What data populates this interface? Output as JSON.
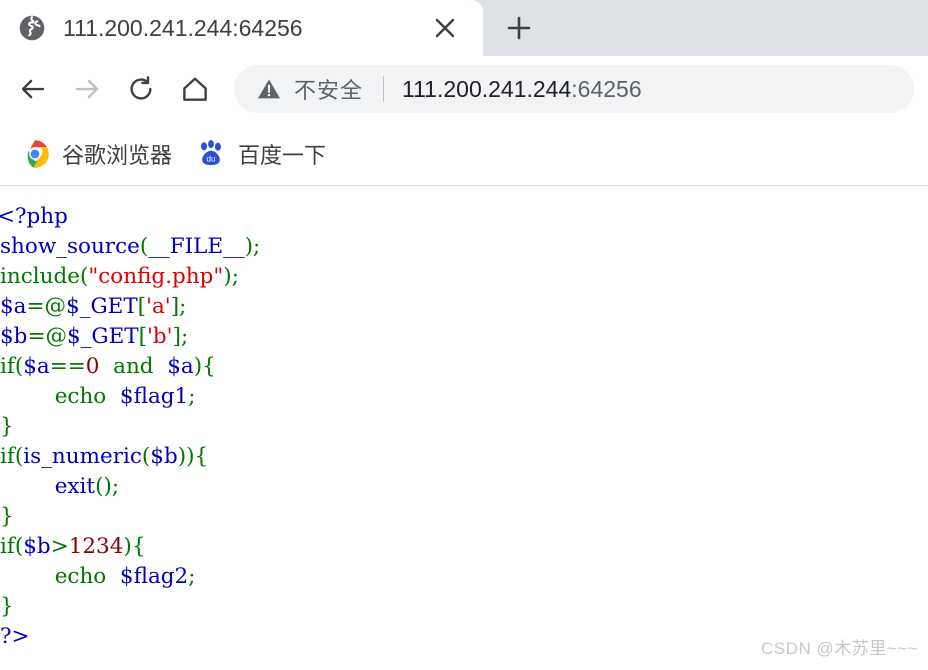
{
  "window": {
    "tab": {
      "favicon": "globe-icon",
      "title": "111.200.241.244:64256",
      "close_label": "✕"
    },
    "new_tab_label": "+"
  },
  "toolbar": {
    "back_label": "←",
    "forward_label": "→",
    "reload_label": "↻",
    "home_label": "⌂",
    "security": {
      "icon": "warning-triangle-icon",
      "text": "不安全"
    },
    "url_host": "111.200.241.244",
    "url_port": ":64256"
  },
  "bookmarks": [
    {
      "icon": "chrome-logo-icon",
      "label": "谷歌浏览器"
    },
    {
      "icon": "baidu-paw-icon",
      "label": "百度一下"
    }
  ],
  "page": {
    "code_lines": [
      {
        "tokens": [
          {
            "t": "<?php",
            "c": "var"
          }
        ]
      },
      {
        "tokens": [
          {
            "t": "show_source",
            "c": "var"
          },
          {
            "t": "(",
            "c": "kw"
          },
          {
            "t": "__FILE__",
            "c": "var"
          },
          {
            "t": ")",
            "c": "kw"
          },
          {
            "t": ";",
            "c": "kw"
          }
        ]
      },
      {
        "tokens": [
          {
            "t": "include",
            "c": "kw"
          },
          {
            "t": "(",
            "c": "kw"
          },
          {
            "t": "\"config.php\"",
            "c": "str"
          },
          {
            "t": ")",
            "c": "kw"
          },
          {
            "t": ";",
            "c": "kw"
          }
        ]
      },
      {
        "tokens": [
          {
            "t": "$a",
            "c": "var"
          },
          {
            "t": "=@",
            "c": "kw"
          },
          {
            "t": "$_GET",
            "c": "var"
          },
          {
            "t": "[",
            "c": "kw"
          },
          {
            "t": "'a'",
            "c": "str"
          },
          {
            "t": "]",
            "c": "kw"
          },
          {
            "t": ";",
            "c": "kw"
          }
        ]
      },
      {
        "tokens": [
          {
            "t": "$b",
            "c": "var"
          },
          {
            "t": "=@",
            "c": "kw"
          },
          {
            "t": "$_GET",
            "c": "var"
          },
          {
            "t": "[",
            "c": "kw"
          },
          {
            "t": "'b'",
            "c": "str"
          },
          {
            "t": "]",
            "c": "kw"
          },
          {
            "t": ";",
            "c": "kw"
          }
        ]
      },
      {
        "tokens": [
          {
            "t": "if",
            "c": "kw"
          },
          {
            "t": "(",
            "c": "kw"
          },
          {
            "t": "$a",
            "c": "var"
          },
          {
            "t": "==",
            "c": "kw"
          },
          {
            "t": "0",
            "c": "num"
          },
          {
            "t": "  ",
            "c": "kw"
          },
          {
            "t": "and",
            "c": "kw"
          },
          {
            "t": "  ",
            "c": "kw"
          },
          {
            "t": "$a",
            "c": "var"
          },
          {
            "t": ")",
            "c": "kw"
          },
          {
            "t": "{",
            "c": "kw"
          }
        ]
      },
      {
        "tokens": [
          {
            "t": "        ",
            "c": "kw"
          },
          {
            "t": "echo",
            "c": "kw"
          },
          {
            "t": "  ",
            "c": "kw"
          },
          {
            "t": "$flag1",
            "c": "var"
          },
          {
            "t": ";",
            "c": "kw"
          }
        ]
      },
      {
        "tokens": [
          {
            "t": "}",
            "c": "kw"
          }
        ]
      },
      {
        "tokens": [
          {
            "t": "if",
            "c": "kw"
          },
          {
            "t": "(",
            "c": "kw"
          },
          {
            "t": "is_numeric",
            "c": "var"
          },
          {
            "t": "(",
            "c": "kw"
          },
          {
            "t": "$b",
            "c": "var"
          },
          {
            "t": ")",
            "c": "kw"
          },
          {
            "t": ")",
            "c": "kw"
          },
          {
            "t": "{",
            "c": "kw"
          }
        ]
      },
      {
        "tokens": [
          {
            "t": "        ",
            "c": "kw"
          },
          {
            "t": "exit",
            "c": "var"
          },
          {
            "t": "()",
            "c": "kw"
          },
          {
            "t": ";",
            "c": "kw"
          }
        ]
      },
      {
        "tokens": [
          {
            "t": "}",
            "c": "kw"
          }
        ]
      },
      {
        "tokens": [
          {
            "t": "if",
            "c": "kw"
          },
          {
            "t": "(",
            "c": "kw"
          },
          {
            "t": "$b",
            "c": "var"
          },
          {
            "t": ">",
            "c": "kw"
          },
          {
            "t": "1234",
            "c": "num"
          },
          {
            "t": ")",
            "c": "kw"
          },
          {
            "t": "{",
            "c": "kw"
          }
        ]
      },
      {
        "tokens": [
          {
            "t": "        ",
            "c": "kw"
          },
          {
            "t": "echo",
            "c": "kw"
          },
          {
            "t": "  ",
            "c": "kw"
          },
          {
            "t": "$flag2",
            "c": "var"
          },
          {
            "t": ";",
            "c": "kw"
          }
        ]
      },
      {
        "tokens": [
          {
            "t": "}",
            "c": "kw"
          }
        ]
      },
      {
        "tokens": [
          {
            "t": "?>",
            "c": "var"
          }
        ]
      }
    ],
    "watermark": "CSDN @木苏里~~~"
  }
}
